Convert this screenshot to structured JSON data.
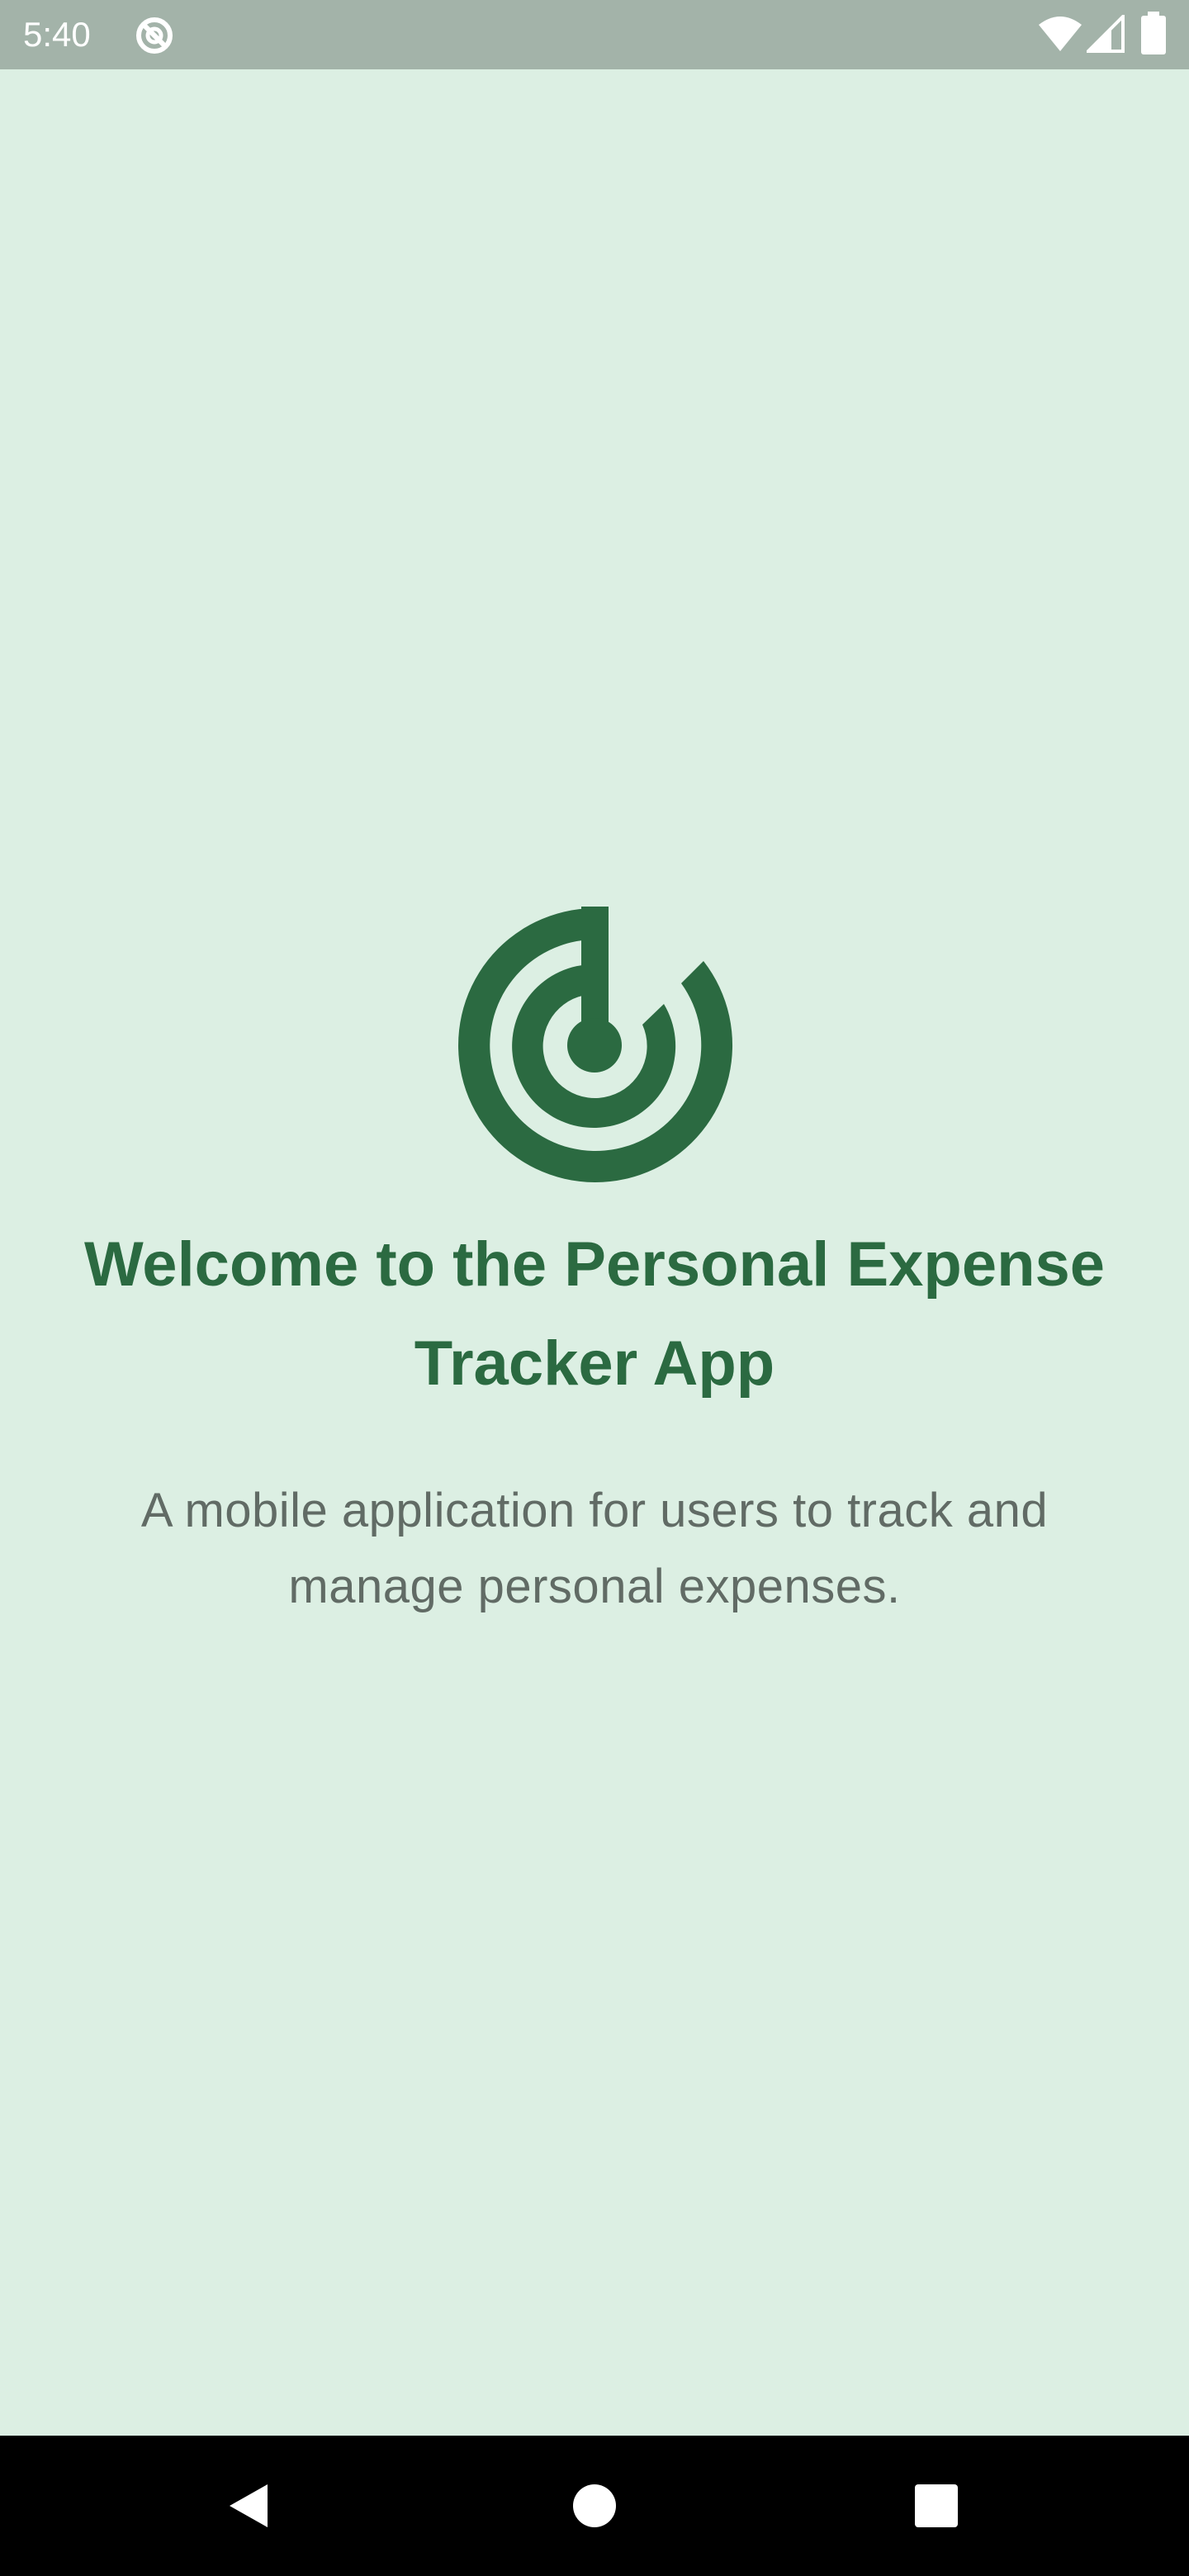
{
  "status_bar": {
    "time": "5:40",
    "icons": [
      "do-not-disturb-icon",
      "wifi-icon",
      "cell-signal-icon",
      "battery-icon"
    ]
  },
  "welcome": {
    "title": "Welcome to the Personal Expense Tracker App",
    "description": "A mobile application for users to track and manage personal expenses.",
    "logo_icon": "target-power-logo-icon"
  },
  "nav_bar": {
    "buttons": [
      "back-icon",
      "home-icon",
      "recents-icon"
    ]
  },
  "colors": {
    "background": "#dcefe3",
    "accent": "#2b6a41",
    "status_bar": "#a3b3a9",
    "description_text": "#616b65",
    "nav_bar": "#000000"
  }
}
